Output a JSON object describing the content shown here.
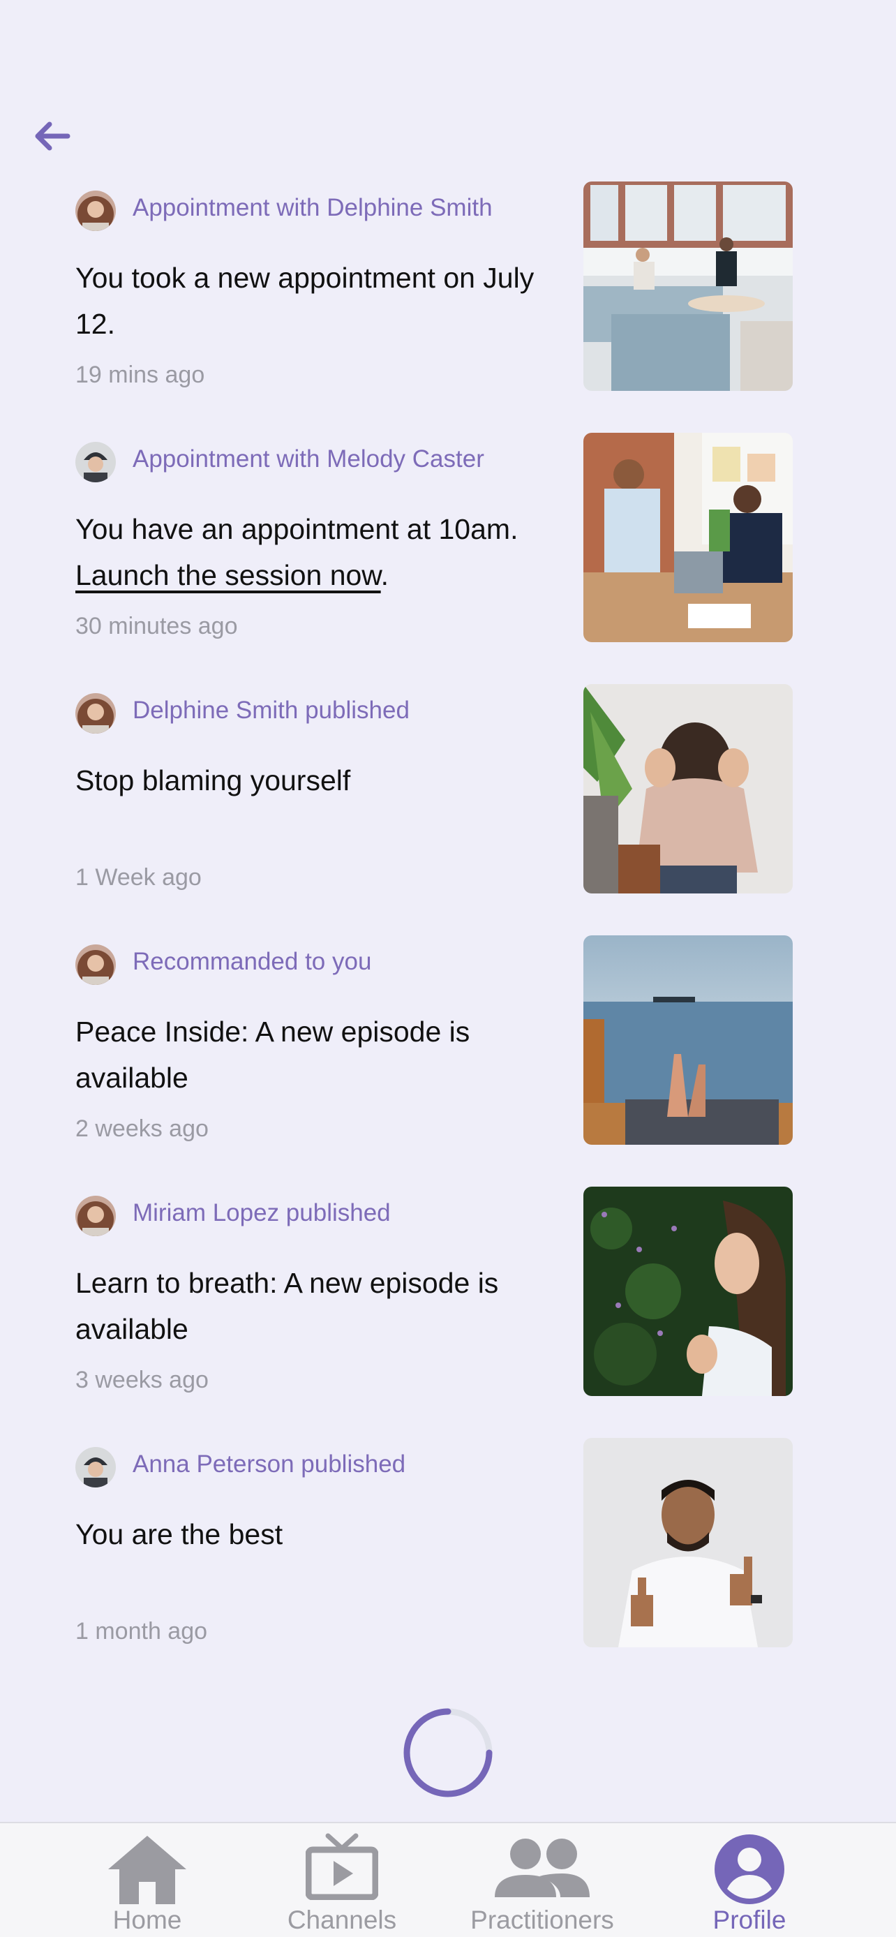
{
  "nav": {
    "back_icon": "arrow-left-icon"
  },
  "notifications": [
    {
      "headline": "Appointment with Delphine Smith",
      "avatar": "woman-avatar",
      "text": "You took a new appointment on July 12.",
      "link": "",
      "time": "19 mins ago",
      "thumbnail": "office-lounge-photo"
    },
    {
      "headline": "Appointment with Melody Caster",
      "avatar": "woman-beanie-avatar",
      "text": "You have an appointment at 10am.",
      "link": "Launch the session now",
      "link_suffix": ".",
      "time": "30 minutes ago",
      "thumbnail": "high-five-meeting-photo"
    },
    {
      "headline": "Delphine Smith published",
      "avatar": "woman-avatar",
      "text": "Stop blaming yourself",
      "link": "",
      "time": "1 Week ago",
      "thumbnail": "stressed-woman-photo"
    },
    {
      "headline": "Recommanded to you",
      "avatar": "woman-avatar",
      "text": "Peace Inside: A new episode is available",
      "link": "",
      "time": "2 weeks ago",
      "thumbnail": "sea-view-photo"
    },
    {
      "headline": "Miriam Lopez published",
      "avatar": "woman-avatar",
      "text": "Learn to breath: A new episode is available",
      "link": "",
      "time": "3 weeks ago",
      "thumbnail": "woman-breathing-photo"
    },
    {
      "headline": "Anna Peterson published",
      "avatar": "woman-beanie-avatar",
      "text": "You are the best",
      "link": "",
      "time": "1 month ago",
      "thumbnail": "man-thumbs-up-photo"
    }
  ],
  "loading": {
    "icon": "loading-spinner"
  },
  "tabbar": {
    "tabs": [
      {
        "label": "Home",
        "icon": "home-icon",
        "active": false
      },
      {
        "label": "Channels",
        "icon": "tv-icon",
        "active": false
      },
      {
        "label": "Practitioners",
        "icon": "people-icon",
        "active": false
      },
      {
        "label": "Profile",
        "icon": "profile-icon",
        "active": true
      }
    ]
  },
  "colors": {
    "background": "#efeef9",
    "accent": "#7566b8",
    "headline": "#7d6bb8",
    "muted": "#9a9aa3",
    "tabbar": "#f6f6f8"
  }
}
